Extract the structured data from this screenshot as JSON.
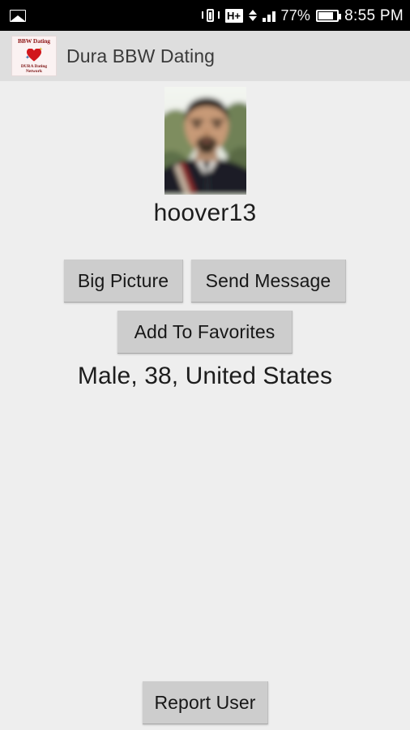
{
  "status_bar": {
    "gallery_icon": "gallery-icon",
    "vibrate_icon": "vibrate-icon",
    "network_type": "H+",
    "data_arrows_icon": "data-transfer-arrows-icon",
    "signal_icon": "signal-bars-icon",
    "battery_percent": "77%",
    "battery_icon": "battery-icon",
    "time": "8:55 PM"
  },
  "app_bar": {
    "logo": {
      "icon_name": "app-logo-icon",
      "top_text": "BBW Dating",
      "heart_icon": "heart-icon",
      "bottom_line1": "DURA Dating",
      "bottom_line2": "Network"
    },
    "title": "Dura BBW Dating"
  },
  "profile": {
    "photo_alt": "profile-photo",
    "username": "hoover13",
    "info_line": "Male, 38, United States"
  },
  "actions": {
    "big_picture": "Big Picture",
    "send_message": "Send Message",
    "add_to_favorites": "Add To Favorites",
    "report_user": "Report User"
  },
  "colors": {
    "status_bar_bg": "#000000",
    "app_bar_bg": "#dedede",
    "page_bg": "#eeeeee",
    "button_bg": "#cdcdcd",
    "text_primary": "#1d1d1d",
    "logo_red": "#d1161b"
  }
}
